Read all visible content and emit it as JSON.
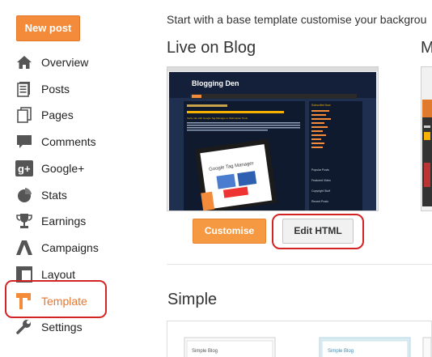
{
  "sidebar": {
    "new_post_label": "New post",
    "items": [
      {
        "label": "Overview",
        "icon": "home-icon"
      },
      {
        "label": "Posts",
        "icon": "posts-icon"
      },
      {
        "label": "Pages",
        "icon": "pages-icon"
      },
      {
        "label": "Comments",
        "icon": "comments-icon"
      },
      {
        "label": "Google+",
        "icon": "google-plus-icon"
      },
      {
        "label": "Stats",
        "icon": "stats-icon"
      },
      {
        "label": "Earnings",
        "icon": "trophy-icon"
      },
      {
        "label": "Campaigns",
        "icon": "campaigns-icon"
      },
      {
        "label": "Layout",
        "icon": "layout-icon"
      },
      {
        "label": "Template",
        "icon": "template-icon",
        "active": true
      },
      {
        "label": "Settings",
        "icon": "wrench-icon"
      }
    ]
  },
  "main": {
    "intro": "Start with a base template customise your backgrou",
    "live_title": "Live on Blog",
    "mobile_title_partial": "M",
    "customise_label": "Customise",
    "edit_html_label": "Edit HTML",
    "simple_title": "Simple",
    "preview": {
      "blog_title": "Blogging Den",
      "post_title": "Verify site with Google Tag Manager in Webmaster Tools",
      "image_label": "Google Tag Manager",
      "side_heading": "Subscribe Now",
      "sidebar_items": [
        "Popular Posts",
        "Featured Video",
        "Copyright Stuff",
        "Recent Posts"
      ]
    },
    "simple_thumbs": [
      "Simple Blog",
      "Simple Blog"
    ]
  },
  "colors": {
    "accent_orange": "#f38b3a",
    "highlight_red": "#d42323",
    "preview_navy": "#1e2f4f"
  }
}
